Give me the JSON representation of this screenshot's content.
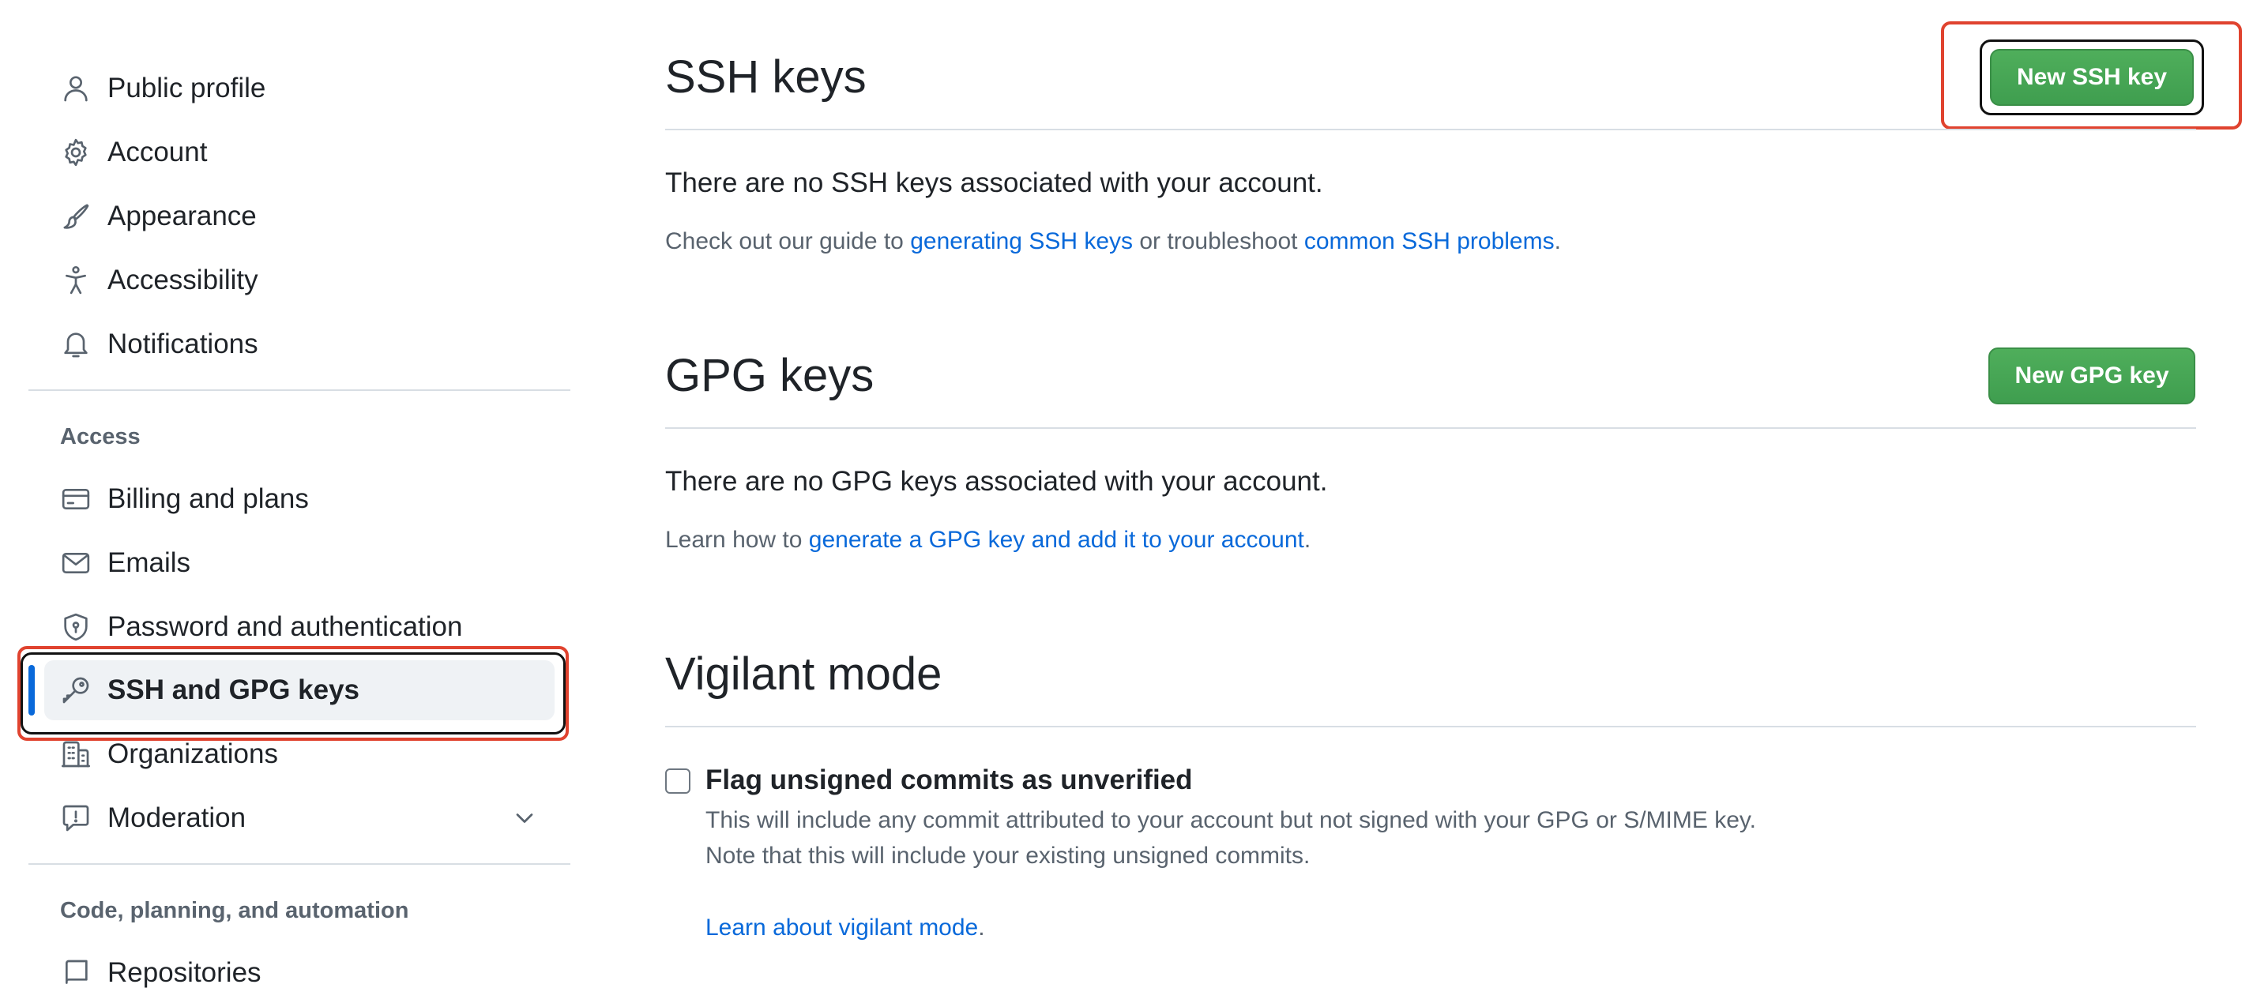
{
  "sidebar": {
    "items": [
      {
        "label": "Public profile",
        "icon": "person-icon"
      },
      {
        "label": "Account",
        "icon": "gear-icon"
      },
      {
        "label": "Appearance",
        "icon": "paintbrush-icon"
      },
      {
        "label": "Accessibility",
        "icon": "accessibility-icon"
      },
      {
        "label": "Notifications",
        "icon": "bell-icon"
      }
    ],
    "access_heading": "Access",
    "access_items": [
      {
        "label": "Billing and plans",
        "icon": "credit-card-icon"
      },
      {
        "label": "Emails",
        "icon": "mail-icon"
      },
      {
        "label": "Password and authentication",
        "icon": "shield-lock-icon"
      },
      {
        "label": "SSH and GPG keys",
        "icon": "key-icon",
        "active": true
      },
      {
        "label": "Organizations",
        "icon": "organization-icon"
      },
      {
        "label": "Moderation",
        "icon": "report-icon",
        "expandable": true
      }
    ],
    "code_heading": "Code, planning, and automation",
    "code_items": [
      {
        "label": "Repositories",
        "icon": "repo-icon"
      }
    ]
  },
  "ssh": {
    "title": "SSH keys",
    "button": "New SSH key",
    "empty": "There are no SSH keys associated with your account.",
    "guide_prefix": "Check out our guide to ",
    "guide_link1": "generating SSH keys",
    "guide_middle": " or troubleshoot ",
    "guide_link2": "common SSH problems",
    "guide_suffix": "."
  },
  "gpg": {
    "title": "GPG keys",
    "button": "New GPG key",
    "empty": "There are no GPG keys associated with your account.",
    "learn_prefix": "Learn how to ",
    "learn_link": "generate a GPG key and add it to your account",
    "learn_suffix": "."
  },
  "vigilant": {
    "title": "Vigilant mode",
    "checkbox_label": "Flag unsigned commits as unverified",
    "checkbox_checked": false,
    "desc_line1": "This will include any commit attributed to your account but not signed with your GPG or S/MIME key.",
    "desc_line2": "Note that this will include your existing unsigned commits.",
    "learn_link": "Learn about vigilant mode",
    "learn_suffix": "."
  },
  "colors": {
    "accent": "#0969da",
    "primary_button": "#3f9e4f",
    "highlight": "#e0432f"
  }
}
